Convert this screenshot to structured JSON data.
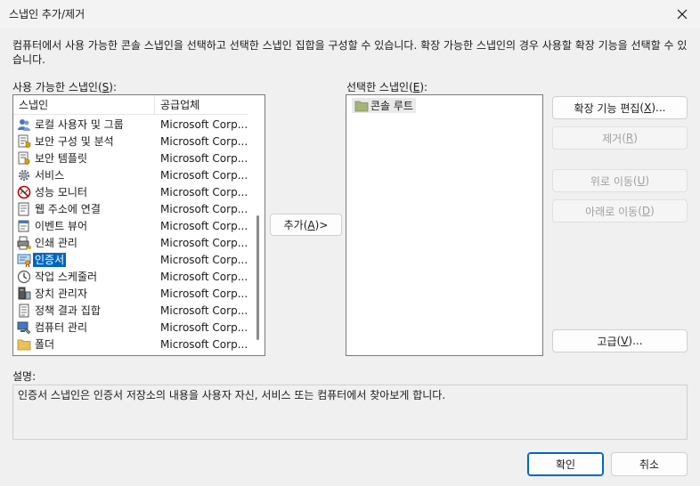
{
  "window": {
    "title": "스냅인 추가/제거"
  },
  "description": "컴퓨터에서 사용 가능한 콘솔 스냅인을 선택하고 선택한 스냅인 집합을 구성할 수 있습니다. 확장 가능한 스냅인의 경우 사용할 확장 기능을 선택할 수 있습니다.",
  "available": {
    "label": "사용 가능한 스냅인",
    "accesskey": "S",
    "columns": [
      "스냅인",
      "공급업체"
    ],
    "items": [
      {
        "name": "로컬 사용자 및 그룹",
        "vendor": "Microsoft Corp...",
        "icon": "users-icon"
      },
      {
        "name": "보안 구성 및 분석",
        "vendor": "Microsoft Corp...",
        "icon": "security-config-icon"
      },
      {
        "name": "보안 템플릿",
        "vendor": "Microsoft Corp...",
        "icon": "security-template-icon"
      },
      {
        "name": "서비스",
        "vendor": "Microsoft Corp...",
        "icon": "services-gear-icon"
      },
      {
        "name": "성능 모니터",
        "vendor": "Microsoft Corp...",
        "icon": "performance-monitor-icon"
      },
      {
        "name": "웹 주소에 연결",
        "vendor": "Microsoft Corp...",
        "icon": "web-link-icon"
      },
      {
        "name": "이벤트 뷰어",
        "vendor": "Microsoft Corp...",
        "icon": "event-viewer-icon"
      },
      {
        "name": "인쇄 관리",
        "vendor": "Microsoft Corp...",
        "icon": "print-management-icon"
      },
      {
        "name": "인증서",
        "vendor": "Microsoft Corp...",
        "icon": "certificates-icon",
        "selected": true
      },
      {
        "name": "작업 스케줄러",
        "vendor": "Microsoft Corp...",
        "icon": "task-scheduler-icon"
      },
      {
        "name": "장치 관리자",
        "vendor": "Microsoft Corp...",
        "icon": "device-manager-icon"
      },
      {
        "name": "정책 결과 집합",
        "vendor": "Microsoft Corp...",
        "icon": "policy-result-icon"
      },
      {
        "name": "컴퓨터 관리",
        "vendor": "Microsoft Corp...",
        "icon": "computer-management-icon"
      },
      {
        "name": "폴더",
        "vendor": "Microsoft Corp...",
        "icon": "folder-icon"
      }
    ]
  },
  "selected": {
    "label": "선택한 스냅인",
    "accesskey": "E",
    "items": [
      {
        "name": "콘솔 루트",
        "icon": "folder-icon"
      }
    ]
  },
  "buttons": {
    "add": {
      "label": "추가",
      "accesskey": "A",
      "suffix": " >"
    },
    "edit_extensions": {
      "label": "확장 기능 편집",
      "accesskey": "X",
      "suffix": "..."
    },
    "remove": {
      "label": "제거",
      "accesskey": "R",
      "suffix": ""
    },
    "move_up": {
      "label": "위로 이동",
      "accesskey": "U",
      "suffix": ""
    },
    "move_down": {
      "label": "아래로 이동",
      "accesskey": "D",
      "suffix": ""
    },
    "advanced": {
      "label": "고급",
      "accesskey": "V",
      "suffix": "..."
    },
    "ok": "확인",
    "cancel": "취소"
  },
  "details": {
    "label": "설명:",
    "text": "인증서 스냅인은 인증서 저장소의 내용을 사용자 자신, 서비스 또는 컴퓨터에서 찾아보게 합니다."
  },
  "colors": {
    "selection": "#0067c0",
    "folder": "#a5b37a"
  }
}
